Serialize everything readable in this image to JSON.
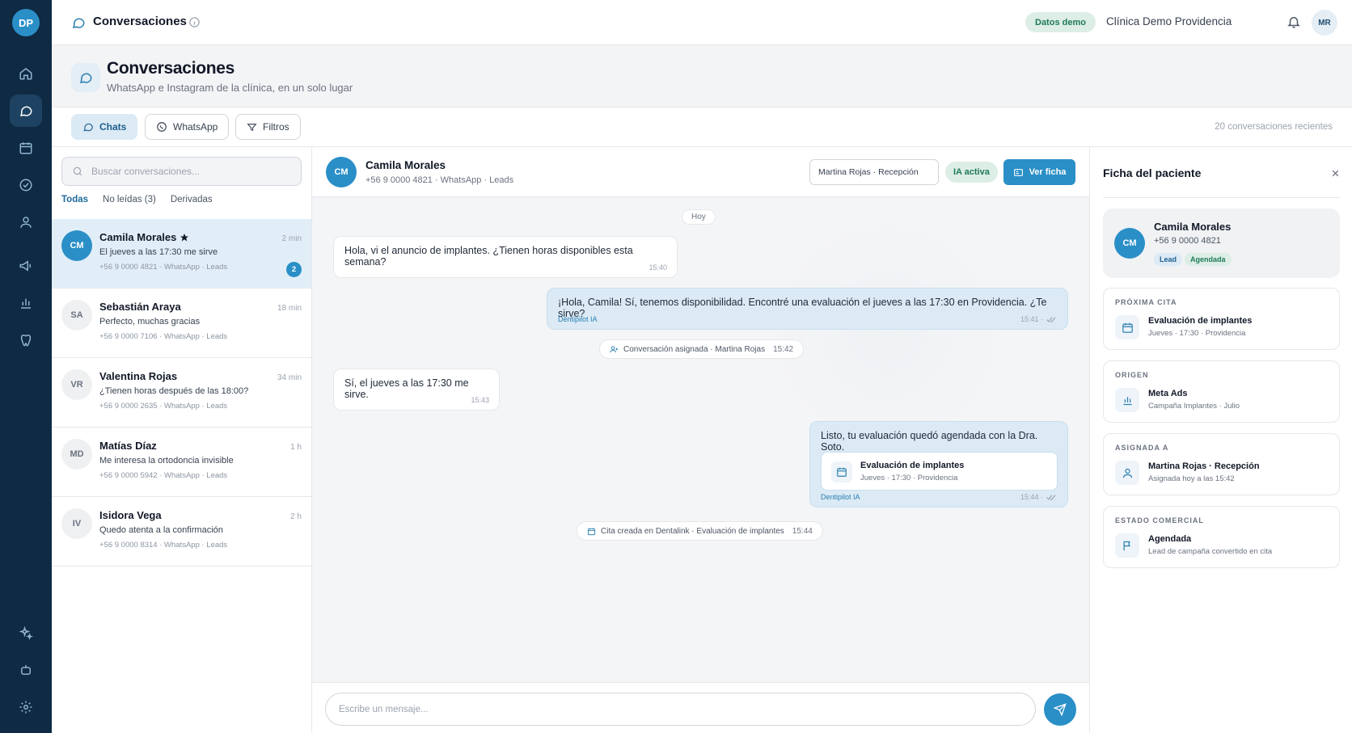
{
  "brand": {
    "initials": "DP"
  },
  "topbar": {
    "title": "Conversaciones",
    "demo_badge": "Datos demo",
    "clinic": "Clínica Demo Providencia",
    "user_initials": "MR"
  },
  "page": {
    "title": "Conversaciones",
    "subtitle": "WhatsApp e Instagram de la clínica, en un solo lugar"
  },
  "tabs": {
    "chats": "Chats",
    "whatsapp": "WhatsApp",
    "filters": "Filtros",
    "recent_count": "20 conversaciones recientes"
  },
  "list": {
    "search_placeholder": "Buscar conversaciones...",
    "filters": [
      "Todas",
      "No leídas (3)",
      "Derivadas"
    ],
    "items": [
      {
        "initials": "CM",
        "name": "Camila Morales",
        "time": "2 min",
        "message": "El jueves a las 17:30 me sirve",
        "meta": "+56 9 0000 4821 · WhatsApp · Leads",
        "unread": "2"
      },
      {
        "initials": "SA",
        "name": "Sebastián Araya",
        "time": "18 min",
        "message": "Perfecto, muchas gracias",
        "meta": "+56 9 0000 7106 · WhatsApp · Leads"
      },
      {
        "initials": "VR",
        "name": "Valentina Rojas",
        "time": "34 min",
        "message": "¿Tienen horas después de las 18:00?",
        "meta": "+56 9 0000 2635 · WhatsApp · Leads"
      },
      {
        "initials": "MD",
        "name": "Matías Díaz",
        "time": "1 h",
        "message": "Me interesa la ortodoncia invisible",
        "meta": "+56 9 0000 5942 · WhatsApp · Leads"
      },
      {
        "initials": "IV",
        "name": "Isidora Vega",
        "time": "2 h",
        "message": "Quedo atenta a la confirmación",
        "meta": "+56 9 0000 8314 · WhatsApp · Leads"
      }
    ]
  },
  "chat": {
    "initials": "CM",
    "name": "Camila Morales",
    "meta": "+56 9 0000 4821 · WhatsApp · Leads",
    "assignee_select": "Martina Rojas · Recepción",
    "ai_badge": "IA activa",
    "view_record": "Ver ficha",
    "day": "Hoy",
    "messages": {
      "m1": {
        "text": "Hola, vi el anuncio de implantes. ¿Tienen horas disponibles esta semana?",
        "time": "15:40"
      },
      "m2": {
        "text": "¡Hola, Camila! Sí, tenemos disponibilidad. Encontré una evaluación el jueves a las 17:30 en Providencia. ¿Te sirve?",
        "time": "15:41 ·",
        "by": "Dentipilot IA"
      },
      "sys1": {
        "text": "Conversación asignada · Martina Rojas",
        "time": "15:42"
      },
      "m3": {
        "text": "Sí, el jueves a las 17:30 me sirve.",
        "time": "15:43"
      },
      "m4": {
        "text": "Listo, tu evaluación quedó agendada con la Dra. Soto.",
        "time": "15:44 ·",
        "by": "Dentipilot IA",
        "card_title": "Evaluación de implantes",
        "card_sub": "Jueves · 17:30 · Providencia"
      },
      "sys2": {
        "text": "Cita creada en Dentalink · Evaluación de implantes",
        "time": "15:44"
      }
    },
    "composer_placeholder": "Escribe un mensaje..."
  },
  "panel": {
    "title": "Ficha del paciente",
    "patient": {
      "initials": "CM",
      "name": "Camila Morales",
      "phone": "+56 9 0000 4821",
      "tags": [
        "Lead",
        "Agendada"
      ]
    },
    "cards": [
      {
        "label": "PRÓXIMA CITA",
        "title": "Evaluación de implantes",
        "sub": "Jueves · 17:30 · Providencia"
      },
      {
        "label": "ORIGEN",
        "title": "Meta Ads",
        "sub": "Campaña Implantes · Julio"
      },
      {
        "label": "ASIGNADA A",
        "title": "Martina Rojas · Recepción",
        "sub": "Asignada hoy a las 15:42"
      },
      {
        "label": "ESTADO COMERCIAL",
        "title": "Agendada",
        "sub": "Lead de campaña convertido en cita"
      }
    ]
  }
}
